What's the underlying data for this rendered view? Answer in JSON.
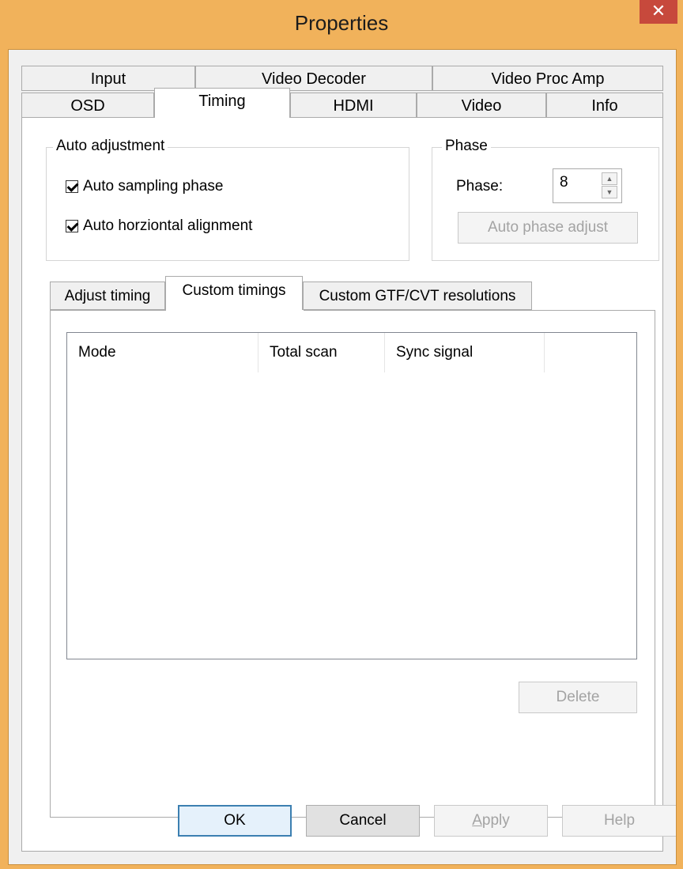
{
  "window": {
    "title": "Properties",
    "close_glyph": "✕"
  },
  "tabs_row1": [
    "Input",
    "Video Decoder",
    "Video Proc Amp"
  ],
  "tabs_row2": [
    "OSD",
    "Timing",
    "HDMI",
    "Video",
    "Info"
  ],
  "active_tab": "Timing",
  "auto_adjustment": {
    "label": "Auto adjustment",
    "auto_sampling_phase": "Auto sampling phase",
    "auto_sampling_checked": true,
    "auto_horizontal_alignment": "Auto horziontal alignment",
    "auto_horizontal_checked": true
  },
  "phase": {
    "label": "Phase",
    "field_label": "Phase:",
    "value": "8",
    "up_glyph": "▲",
    "down_glyph": "▼",
    "auto_button": "Auto phase adjust"
  },
  "subtabs": [
    "Adjust timing",
    "Custom timings",
    "Custom GTF/CVT resolutions"
  ],
  "active_subtab": "Custom timings",
  "list": {
    "columns": [
      "Mode",
      "Total scan",
      "Sync signal",
      ""
    ]
  },
  "buttons": {
    "delete": "Delete",
    "ok": "OK",
    "cancel": "Cancel",
    "apply_underline": "A",
    "apply_rest": "pply",
    "help": "Help"
  }
}
